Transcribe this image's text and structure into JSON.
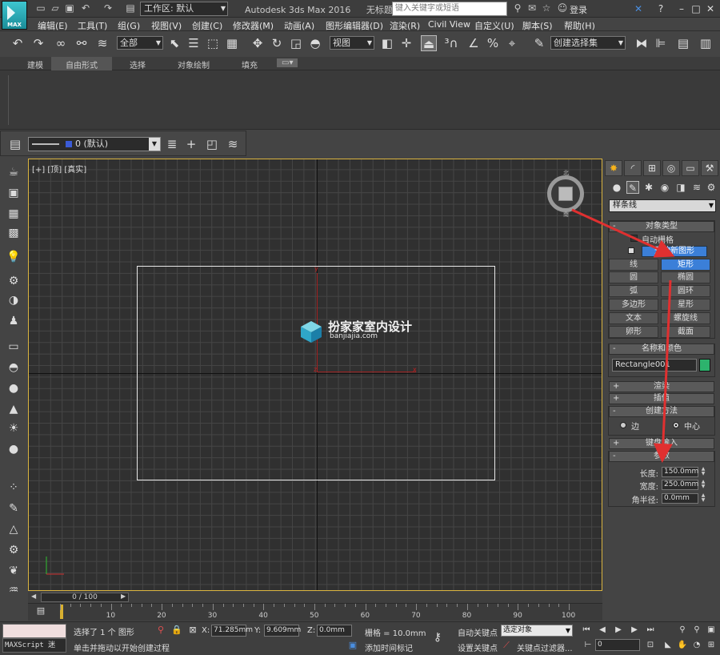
{
  "titlebar": {
    "logo_text": "MAX",
    "workspace": "工作区: 默认",
    "app_title": "Autodesk 3ds Max 2016",
    "doc_title": "无标题",
    "search_placeholder": "键入关键字或短语",
    "sign_in": "登录"
  },
  "menu": [
    "编辑(E)",
    "工具(T)",
    "组(G)",
    "视图(V)",
    "创建(C)",
    "修改器(M)",
    "动画(A)",
    "图形编辑器(D)",
    "渲染(R)",
    "Civil View",
    "自定义(U)",
    "脚本(S)",
    "帮助(H)"
  ],
  "toolbar": {
    "selection_filter": "全部",
    "ref_coord": "视图",
    "named_selection": "创建选择集"
  },
  "ribbon": {
    "tabs": [
      "建模",
      "自由形式",
      "选择",
      "对象绘制",
      "填充"
    ],
    "active_tab": "自由形式"
  },
  "layer": {
    "current": "0 (默认)"
  },
  "viewport": {
    "label": "[+] [顶] [真实]",
    "watermark_cn": "扮家家室内设计",
    "watermark_en": "banjiajia.com",
    "cube_top": "北",
    "cube_bottom": "南",
    "axis_y": "y",
    "axis_x": "x",
    "axis_z": "z"
  },
  "command_panel": {
    "category": "样条线",
    "object_type_title": "对象类型",
    "auto_grid": "自动栅格",
    "start_new_shape": "开始新图形",
    "objects": [
      [
        "线",
        "矩形"
      ],
      [
        "圆",
        "椭圆"
      ],
      [
        "弧",
        "圆环"
      ],
      [
        "多边形",
        "星形"
      ],
      [
        "文本",
        "螺旋线"
      ],
      [
        "卵形",
        "截面"
      ]
    ],
    "selected_object": "矩形",
    "name_color_title": "名称和颜色",
    "object_name": "Rectangle001",
    "object_color": "#2db36d",
    "rollouts_collapsed": [
      "渲染",
      "插值"
    ],
    "creation_method_title": "创建方法",
    "creation_edge": "边",
    "creation_center": "中心",
    "keyboard_entry": "键盘输入",
    "parameters_title": "参数",
    "params": [
      {
        "label": "长度:",
        "value": "150.0mm"
      },
      {
        "label": "宽度:",
        "value": "250.0mm"
      },
      {
        "label": "角半径:",
        "value": "0.0mm"
      }
    ]
  },
  "timeline": {
    "frame_display": "0 / 100",
    "ticks": [
      "10",
      "20",
      "30",
      "40",
      "50",
      "60",
      "70",
      "80",
      "90",
      "100"
    ]
  },
  "status": {
    "maxscript_label": "MAXScript 迷",
    "selected": "选择了 1 个 图形",
    "prompt": "单击并拖动以开始创建过程",
    "x_label": "X:",
    "x_value": "71.285mm",
    "y_label": "Y:",
    "y_value": "9.609mm",
    "z_label": "Z:",
    "z_value": "0.0mm",
    "grid": "栅格 = 10.0mm",
    "add_time_tag": "添加时间标记",
    "auto_key": "自动关键点",
    "selected_object": "选定对象",
    "set_key": "设置关键点",
    "key_filters": "关键点过滤器...",
    "frame": "0"
  },
  "colors": {
    "accent_blue": "#3b7fd8",
    "viewport_border": "#d9b33f",
    "arrow": "#e03030"
  }
}
